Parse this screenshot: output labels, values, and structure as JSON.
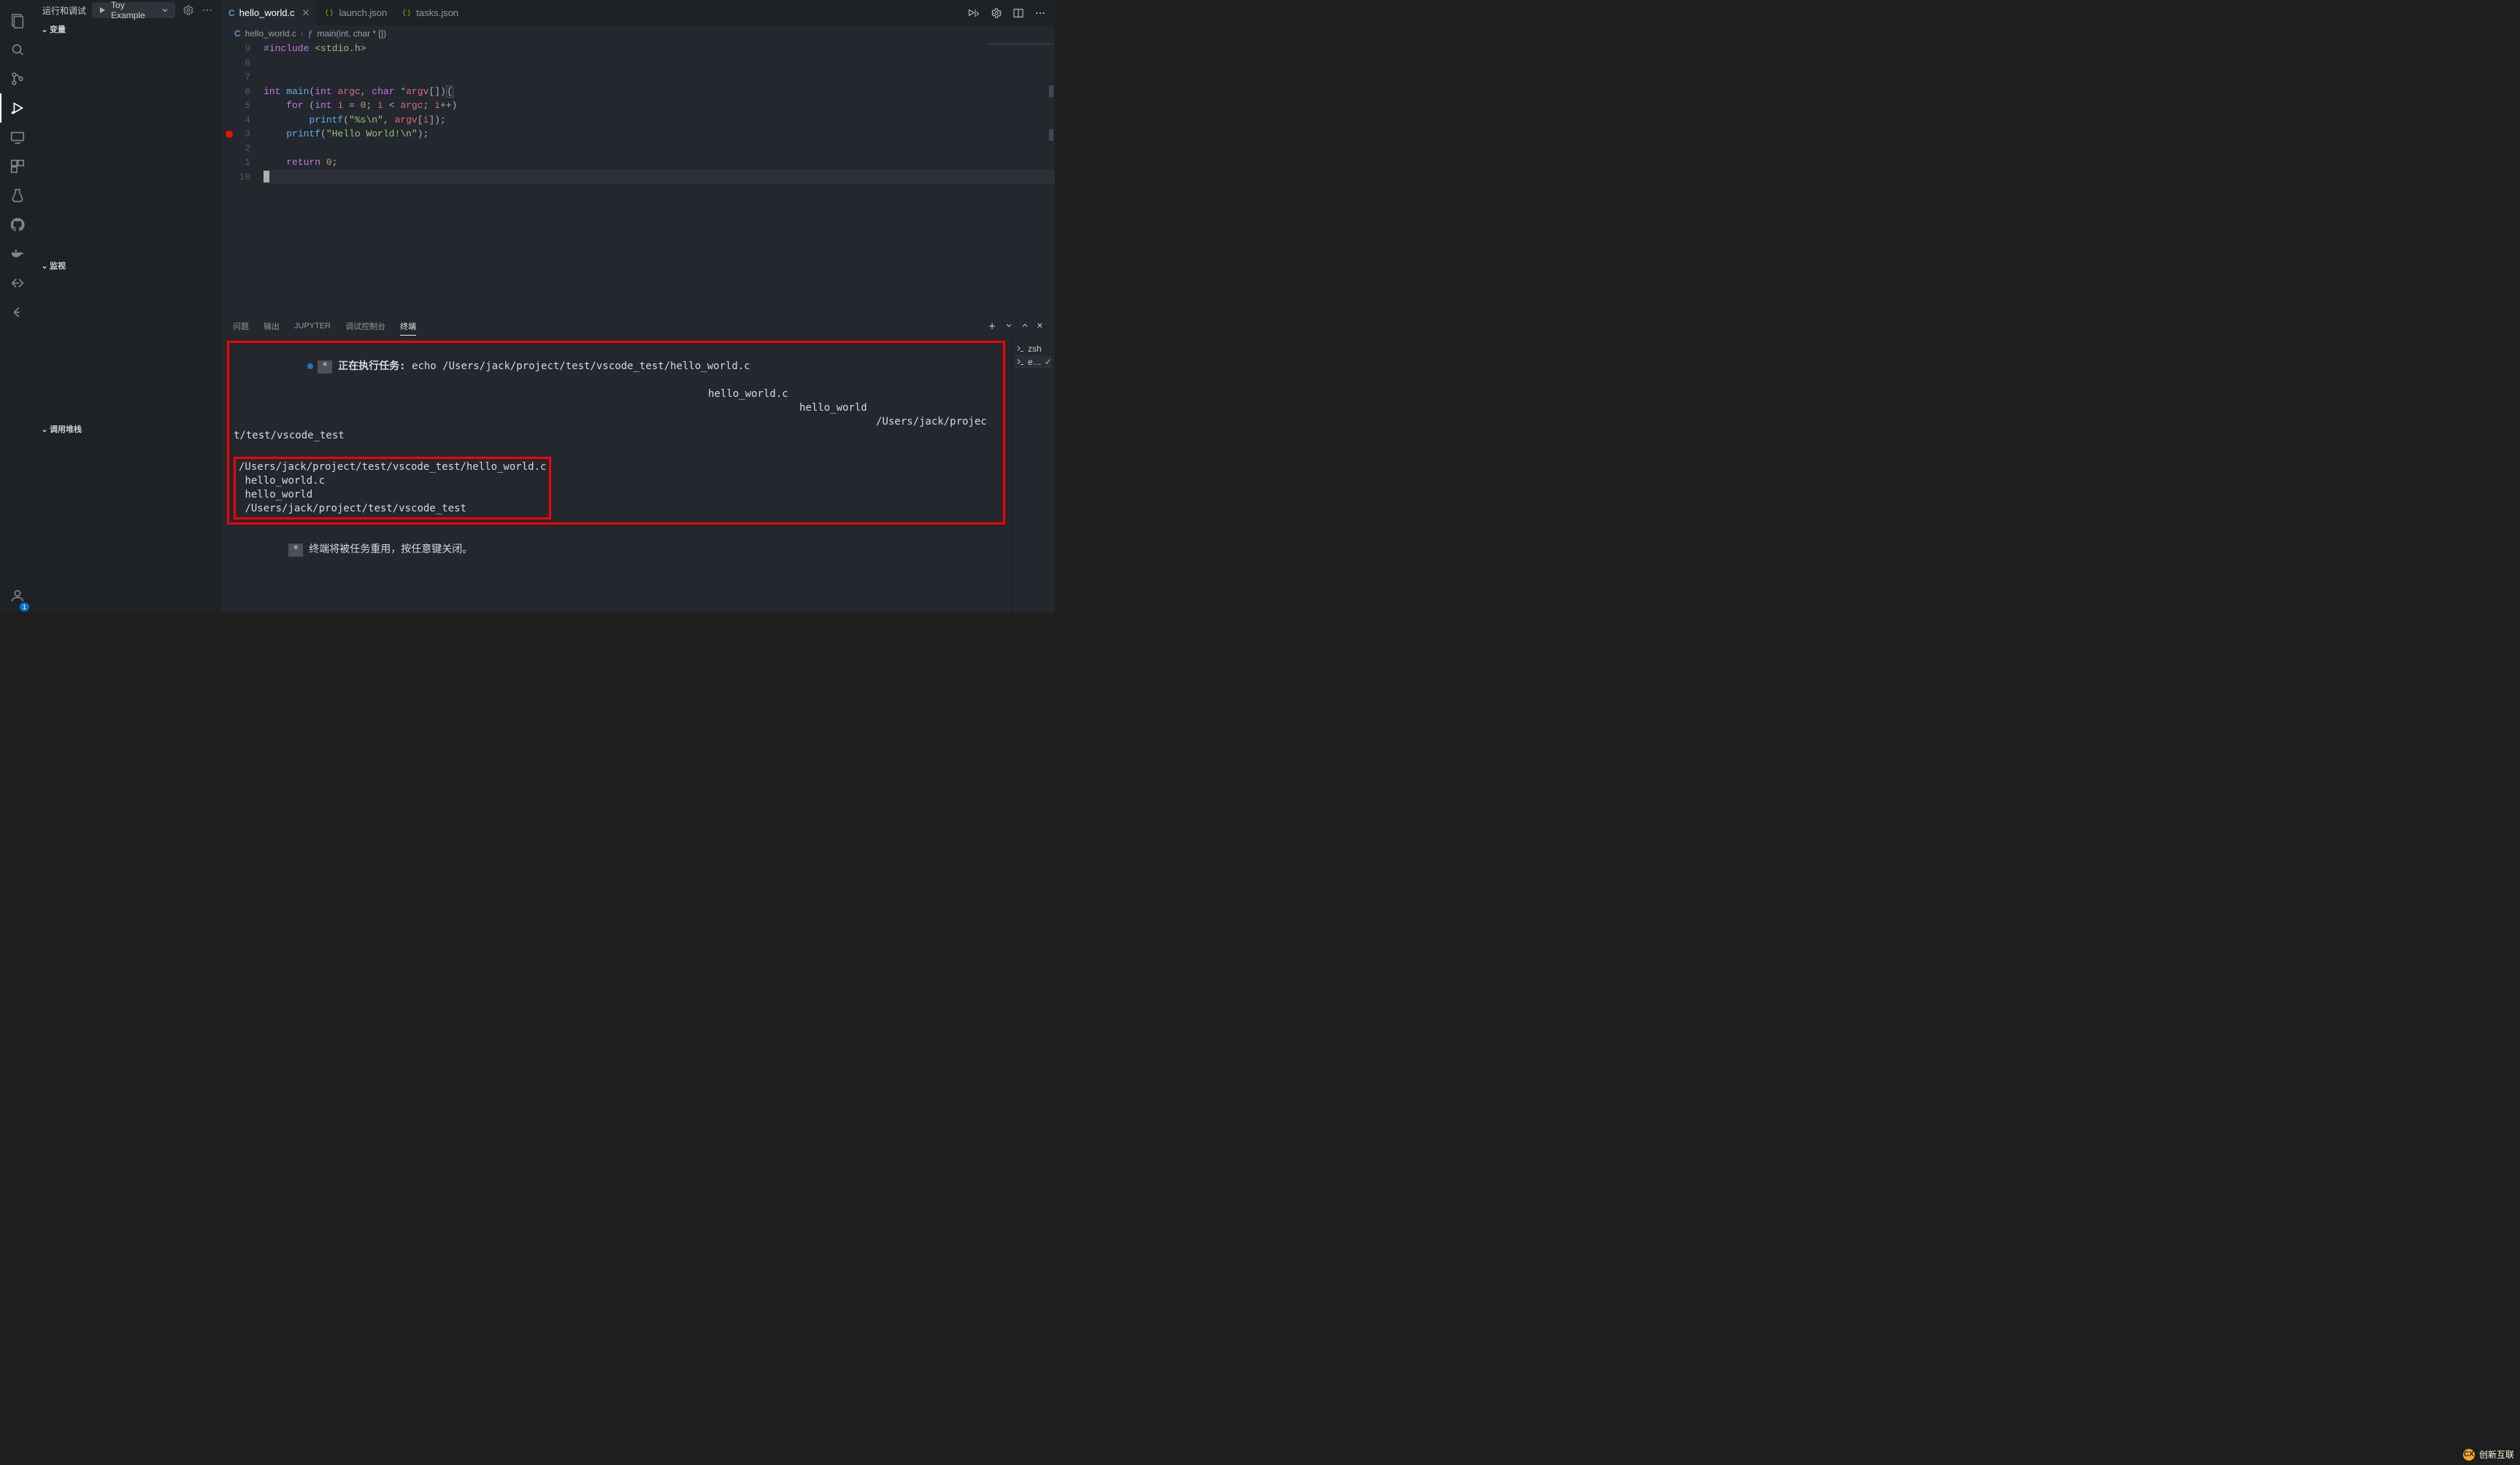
{
  "activity": {
    "items": [
      {
        "name": "explorer"
      },
      {
        "name": "search"
      },
      {
        "name": "scm"
      },
      {
        "name": "run-debug"
      },
      {
        "name": "remote"
      },
      {
        "name": "extensions"
      },
      {
        "name": "testing"
      },
      {
        "name": "github"
      },
      {
        "name": "docker"
      },
      {
        "name": "live-share"
      },
      {
        "name": "azure"
      }
    ],
    "account_badge": "1"
  },
  "sidebar": {
    "title": "运行和调试",
    "config": {
      "name": "Toy Example"
    },
    "sections": {
      "variables": "变量",
      "watch": "监视",
      "callstack": "调用堆栈"
    }
  },
  "tabs": [
    {
      "label": "hello_world.c",
      "kind": "c",
      "active": true
    },
    {
      "label": "launch.json",
      "kind": "json",
      "active": false
    },
    {
      "label": "tasks.json",
      "kind": "json",
      "active": false
    }
  ],
  "tabs_right_icons": [
    "play-debug",
    "gear",
    "split",
    "more"
  ],
  "breadcrumb": {
    "file_icon": "C",
    "file": "hello_world.c",
    "symbol_icon": "ƒ",
    "symbol": "main(int, char * [])"
  },
  "editor": {
    "line_numbers": [
      "9",
      "8",
      "7",
      "6",
      "5",
      "4",
      "3",
      "2",
      "1",
      "10"
    ],
    "breakpoint_at_visual_row": 7,
    "lines": [
      [
        {
          "t": "#include",
          "c": "tok-pre"
        },
        {
          "t": " "
        },
        {
          "t": "<stdio.h>",
          "c": "tok-inc"
        }
      ],
      [],
      [],
      [
        {
          "t": "int ",
          "c": "tok-type"
        },
        {
          "t": "main",
          "c": "tok-fn"
        },
        {
          "t": "("
        },
        {
          "t": "int ",
          "c": "tok-type"
        },
        {
          "t": "argc",
          "c": "tok-var"
        },
        {
          "t": ", "
        },
        {
          "t": "char ",
          "c": "tok-type"
        },
        {
          "t": "*",
          "c": "tok-op"
        },
        {
          "t": "argv",
          "c": "tok-var"
        },
        {
          "t": "[])"
        },
        {
          "t": "{",
          "c": "bracket-hl"
        }
      ],
      [
        {
          "t": "    "
        },
        {
          "t": "for",
          "c": "tok-kw"
        },
        {
          "t": " ("
        },
        {
          "t": "int ",
          "c": "tok-type"
        },
        {
          "t": "i",
          "c": "tok-var"
        },
        {
          "t": " = "
        },
        {
          "t": "0",
          "c": "tok-num"
        },
        {
          "t": "; "
        },
        {
          "t": "i",
          "c": "tok-var"
        },
        {
          "t": " < "
        },
        {
          "t": "argc",
          "c": "tok-var"
        },
        {
          "t": "; "
        },
        {
          "t": "i",
          "c": "tok-var"
        },
        {
          "t": "++)"
        }
      ],
      [
        {
          "t": "        "
        },
        {
          "t": "printf",
          "c": "tok-fn"
        },
        {
          "t": "("
        },
        {
          "t": "\"%s\\n\"",
          "c": "tok-str"
        },
        {
          "t": ", "
        },
        {
          "t": "argv",
          "c": "tok-var"
        },
        {
          "t": "["
        },
        {
          "t": "i",
          "c": "tok-var"
        },
        {
          "t": "]);"
        }
      ],
      [
        {
          "t": "    "
        },
        {
          "t": "printf",
          "c": "tok-fn"
        },
        {
          "t": "("
        },
        {
          "t": "\"Hello World!\\n\"",
          "c": "tok-str"
        },
        {
          "t": ");"
        }
      ],
      [],
      [
        {
          "t": "    "
        },
        {
          "t": "return",
          "c": "tok-kw"
        },
        {
          "t": " "
        },
        {
          "t": "0",
          "c": "tok-num"
        },
        {
          "t": ";"
        }
      ],
      [
        {
          "t": "",
          "cursor": true
        }
      ]
    ]
  },
  "panel": {
    "tabs": [
      "问题",
      "输出",
      "JUPYTER",
      "调试控制台",
      "终端"
    ],
    "active": "终端",
    "terminal": {
      "task_prefix": "正在执行任务: ",
      "task_cmd": "echo /Users/jack/project/test/vscode_test/hello_world.c",
      "wrap1": "hello_world.c",
      "wrap2": "hello_world",
      "wrap3a": "/Users/jack/projec",
      "wrap3b": "t/test/vscode_test",
      "out1": "/Users/jack/project/test/vscode_test/hello_world.c",
      "out2": " hello_world.c",
      "out3": " hello_world",
      "out4": " /Users/jack/project/test/vscode_test",
      "footer": "终端将被任务重用，按任意键关闭。"
    },
    "side": [
      {
        "icon": "terminal",
        "label": "zsh",
        "active": false,
        "check": false
      },
      {
        "icon": "terminal",
        "label": "e…",
        "active": true,
        "check": true
      }
    ]
  },
  "watermark": {
    "text": "创新互联",
    "badge": "CX"
  }
}
